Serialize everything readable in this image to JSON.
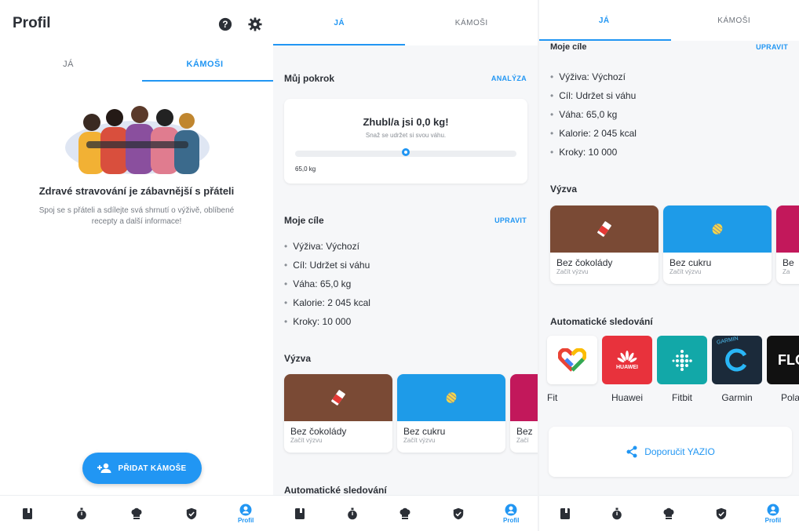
{
  "screen1": {
    "title": "Profil",
    "tabs": [
      "JÁ",
      "KÁMOŠI"
    ],
    "empty_title": "Zdravé stravování je zábavnější s přáteli",
    "empty_text": "Spoj se s přáteli a sdílejte svá shrnutí o výživě, oblíbené recepty a další informace!",
    "fab_label": "PŘIDAT KÁMOŠE",
    "nav_label": "Profil"
  },
  "screen2": {
    "tabs": [
      "JÁ",
      "KÁMOŠI"
    ],
    "progress_title": "Můj pokrok",
    "progress_link": "ANALÝZA",
    "progress_card_title": "Zhubl/a jsi 0,0 kg!",
    "progress_card_sub": "Snaž se udržet si svou váhu.",
    "progress_fraction": 0.5,
    "progress_weight": "65,0 kg",
    "goals_title": "Moje cíle",
    "goals_link": "UPRAVIT",
    "goals": [
      "Výživa: Výchozí",
      "Cíl: Udržet si váhu",
      "Váha: 65,0 kg",
      "Kalorie: 2 045 kcal",
      "Kroky: 10 000"
    ],
    "challenge_title": "Výzva",
    "challenges": [
      {
        "name": "Bez čokolády",
        "sub": "Začít výzvu",
        "color": "#7a4a35"
      },
      {
        "name": "Bez cukru",
        "sub": "Začít výzvu",
        "color": "#1e9be8"
      },
      {
        "name": "Bez",
        "sub": "Začí",
        "color": "#c2185b"
      }
    ],
    "tracking_title": "Automatické sledování",
    "nav_label": "Profil"
  },
  "screen3": {
    "tabs": [
      "JÁ",
      "KÁMOŠI"
    ],
    "goals_title": "Moje cíle",
    "goals_link": "UPRAVIT",
    "goals": [
      "Výživa: Výchozí",
      "Cíl: Udržet si váhu",
      "Váha: 65,0 kg",
      "Kalorie: 2 045 kcal",
      "Kroky: 10 000"
    ],
    "challenge_title": "Výzva",
    "challenges": [
      {
        "name": "Bez čokolády",
        "sub": "Začít výzvu",
        "color": "#7a4a35"
      },
      {
        "name": "Bez cukru",
        "sub": "Začít výzvu",
        "color": "#1e9be8"
      },
      {
        "name": "Be",
        "sub": "Za",
        "color": "#c2185b"
      }
    ],
    "tracking_title": "Automatické sledování",
    "apps": [
      {
        "name": "Fit",
        "color": "#ffffff",
        "icon": "google-fit-icon"
      },
      {
        "name": "Huawei",
        "color": "#e8323c",
        "icon": "huawei-icon",
        "text": "HUAWEI"
      },
      {
        "name": "Fitbit",
        "color": "#12a8a8",
        "icon": "fitbit-icon"
      },
      {
        "name": "Garmin",
        "color": "#1b2a3a",
        "icon": "garmin-icon",
        "text": "GARMIN"
      },
      {
        "name": "Polar",
        "color": "#111111",
        "icon": "polar-icon",
        "text": "FLO"
      }
    ],
    "recommend_label": "Doporučit YAZIO",
    "nav_label": "Profil"
  },
  "colors": {
    "accent": "#2196f3",
    "text": "#2b2f36"
  }
}
